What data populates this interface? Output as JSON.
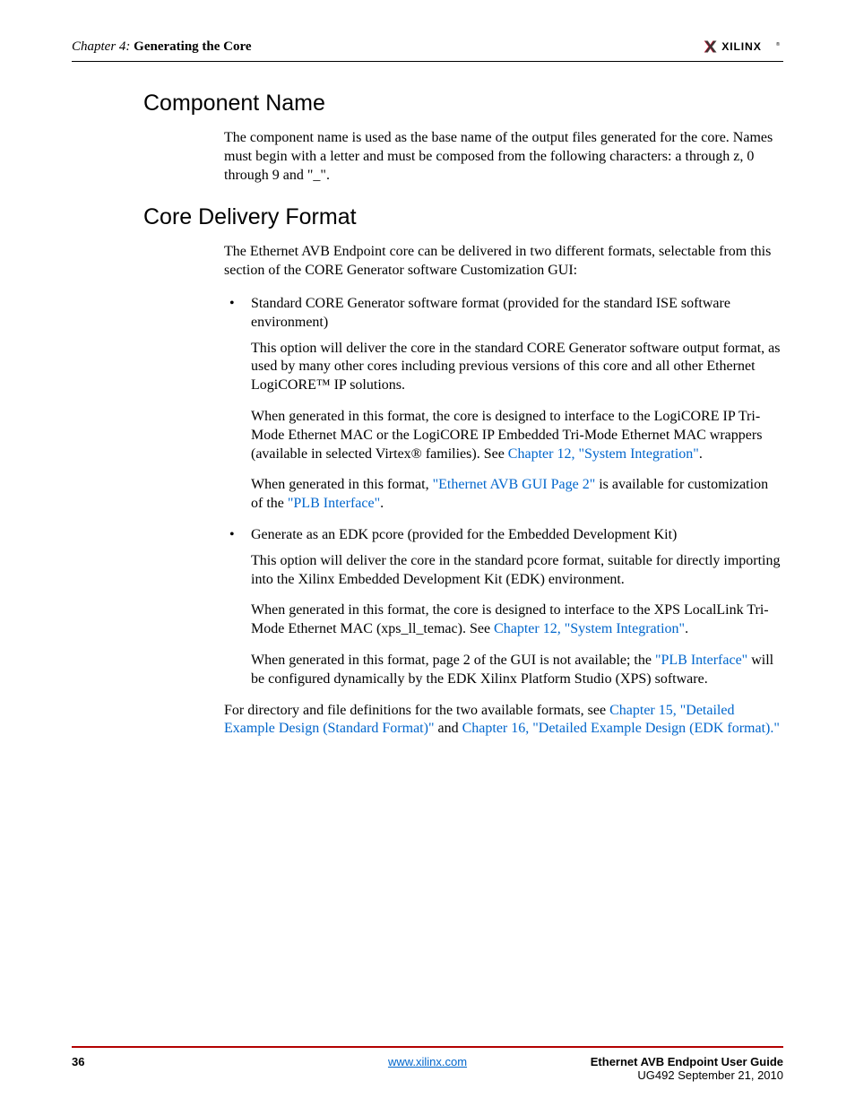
{
  "header": {
    "chapter_prefix": "Chapter 4:",
    "chapter_title": "Generating the Core",
    "logo_text": "XILINX",
    "logo_dot": "®"
  },
  "section1": {
    "title": "Component Name",
    "para1": "The component name is used as the base name of the output files generated for the core. Names must begin with a letter and must be composed from the following characters: a through z, 0 through 9 and \"_\"."
  },
  "section2": {
    "title": "Core Delivery Format",
    "para1": "The Ethernet AVB Endpoint core can be delivered in two different formats, selectable from this section of the CORE Generator software Customization GUI:",
    "bullet1": "Standard CORE Generator software format (provided for the standard ISE software environment)",
    "sub1a": "This option will deliver the core in the standard CORE Generator software output format, as used by many other cores including previous versions of this core and all other Ethernet LogiCORE™ IP solutions.",
    "sub1b_pre": "When generated in this format, the core is designed to interface to the LogiCORE IP Tri-Mode Ethernet MAC or the LogiCORE IP Embedded Tri-Mode Ethernet MAC wrappers (available in selected Virtex® families). See ",
    "sub1b_link": "Chapter 12, \"System Integration\"",
    "sub1b_post": ".",
    "sub1c_pre": "When generated in this format, ",
    "sub1c_link1": "\"Ethernet AVB GUI Page 2\"",
    "sub1c_mid": " is available for customization of the ",
    "sub1c_link2": "\"PLB Interface\"",
    "sub1c_post": ".",
    "bullet2": "Generate as an EDK pcore (provided for the Embedded Development Kit)",
    "sub2a": "This option will deliver the core in the standard pcore format, suitable for directly importing into the Xilinx Embedded Development Kit (EDK) environment.",
    "sub2b_pre": "When generated in this format, the core is designed to interface to the XPS LocalLink Tri-Mode Ethernet MAC (xps_ll_temac). See ",
    "sub2b_link": "Chapter 12, \"System Integration\"",
    "sub2b_post": ".",
    "sub2c_pre": "When generated in this format, page 2 of the GUI is not available; the ",
    "sub2c_link": "\"PLB Interface\"",
    "sub2c_post": " will be configured dynamically by the EDK Xilinx Platform Studio (XPS) software.",
    "closing_pre": "For directory and file definitions for the two available formats, see ",
    "closing_link1": "Chapter 15, \"Detailed Example Design (Standard Format)\"",
    "closing_mid": " and ",
    "closing_link2": "Chapter 16, \"Detailed Example Design (EDK format).\"",
    "closing_post": ""
  },
  "footer": {
    "page": "36",
    "url": "www.xilinx.com",
    "doc_title": "Ethernet AVB Endpoint User Guide",
    "doc_sub": "UG492 September 21, 2010"
  }
}
